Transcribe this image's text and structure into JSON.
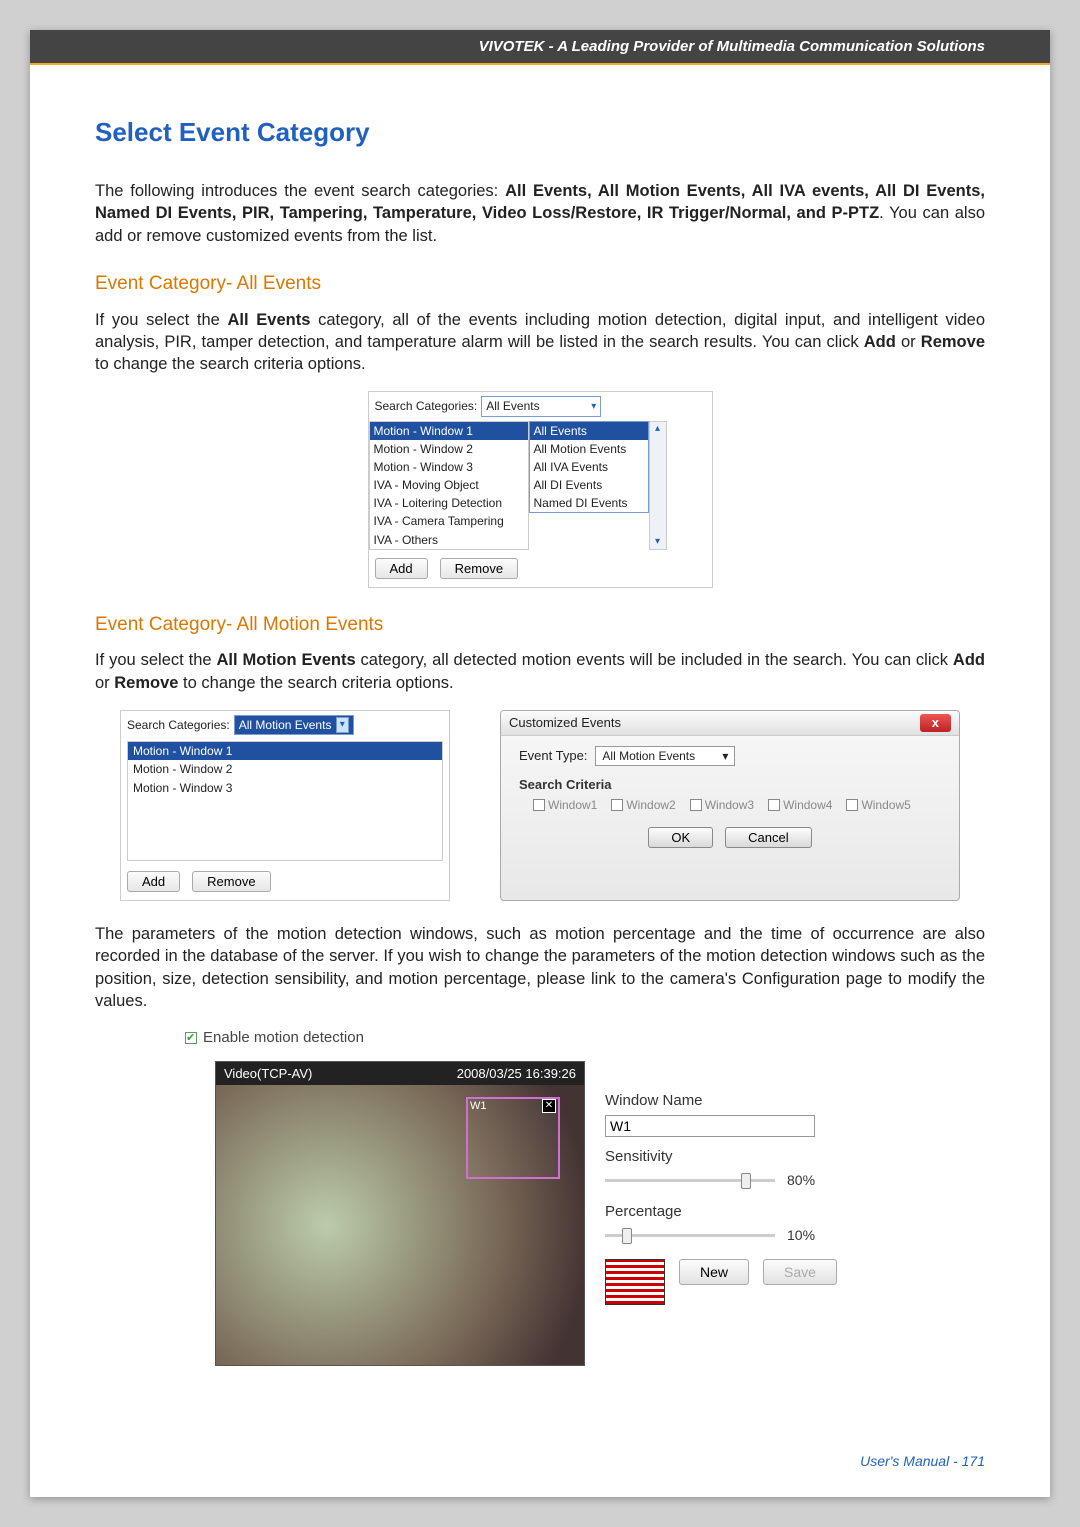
{
  "header": {
    "brand": "VIVOTEK - A Leading Provider of Multimedia Communication Solutions"
  },
  "section": {
    "title": "Select Event Category",
    "intro_prefix": "The following introduces the event search categories: ",
    "intro_bold": "All Events, All Motion Events, All IVA events, All DI Events, Named DI Events, PIR, Tampering, Tamperature, Video Loss/Restore, IR Trigger/Normal, and P-PTZ",
    "intro_suffix": ". You can also add or remove customized events from the list."
  },
  "all_events": {
    "heading": "Event Category- All Events",
    "para_1": "If you select the ",
    "para_bold": "All Events",
    "para_2": " category, all of the events including motion detection, digital input, and intelligent video analysis, PIR, tamper detection, and tamperature alarm will be listed in the search results. You can click ",
    "para_add": "Add",
    "para_or": " or ",
    "para_remove": "Remove",
    "para_3": " to change the search criteria options."
  },
  "fig1": {
    "search_label": "Search Categories:",
    "dropdown_value": "All Events",
    "dropdown_items": [
      "All Events",
      "All Motion Events",
      "All IVA Events",
      "All DI Events",
      "Named DI Events"
    ],
    "left_items": [
      "Motion - Window 1",
      "Motion - Window 2",
      "Motion - Window 3",
      "IVA - Moving Object",
      "IVA - Loitering Detection",
      "IVA - Camera Tampering",
      "IVA - Others"
    ],
    "btn_add": "Add",
    "btn_remove": "Remove"
  },
  "all_motion": {
    "heading": "Event Category- All Motion Events",
    "para_1": "If you select the ",
    "para_bold": "All Motion Events",
    "para_2": " category, all detected motion events will be included in the search. You can click ",
    "para_add": "Add",
    "para_or": " or ",
    "para_remove": "Remove",
    "para_3": " to change the search criteria options."
  },
  "fig2_left": {
    "search_label": "Search Categories:",
    "dropdown_value": "All Motion Events",
    "list_items": [
      "Motion - Window 1",
      "Motion - Window 2",
      "Motion - Window 3"
    ],
    "btn_add": "Add",
    "btn_remove": "Remove"
  },
  "fig2_right": {
    "title": "Customized Events",
    "event_type_label": "Event Type:",
    "event_type_value": "All Motion Events",
    "criteria_label": "Search Criteria",
    "windows": [
      "Window1",
      "Window2",
      "Window3",
      "Window4",
      "Window5"
    ],
    "btn_ok": "OK",
    "btn_cancel": "Cancel"
  },
  "motion_para": {
    "text": "The parameters of the motion detection windows, such as motion percentage and the time of occurrence are also recorded in the database of the server. If you wish to change the parameters of the motion detection windows such as the position, size, detection sensibility, and motion percentage, please link to the camera's Configuration page to modify the values."
  },
  "enable_md": "Enable motion detection",
  "cam": {
    "video_label": "Video(TCP-AV)",
    "timestamp": "2008/03/25 16:39:26",
    "win_name": "W1",
    "window_name_label": "Window Name",
    "window_name_value": "W1",
    "sensitivity_label": "Sensitivity",
    "sensitivity_pct": "80%",
    "percentage_label": "Percentage",
    "percentage_pct": "10%",
    "btn_new": "New",
    "btn_save": "Save"
  },
  "footer": {
    "text": "User's Manual - 171"
  }
}
